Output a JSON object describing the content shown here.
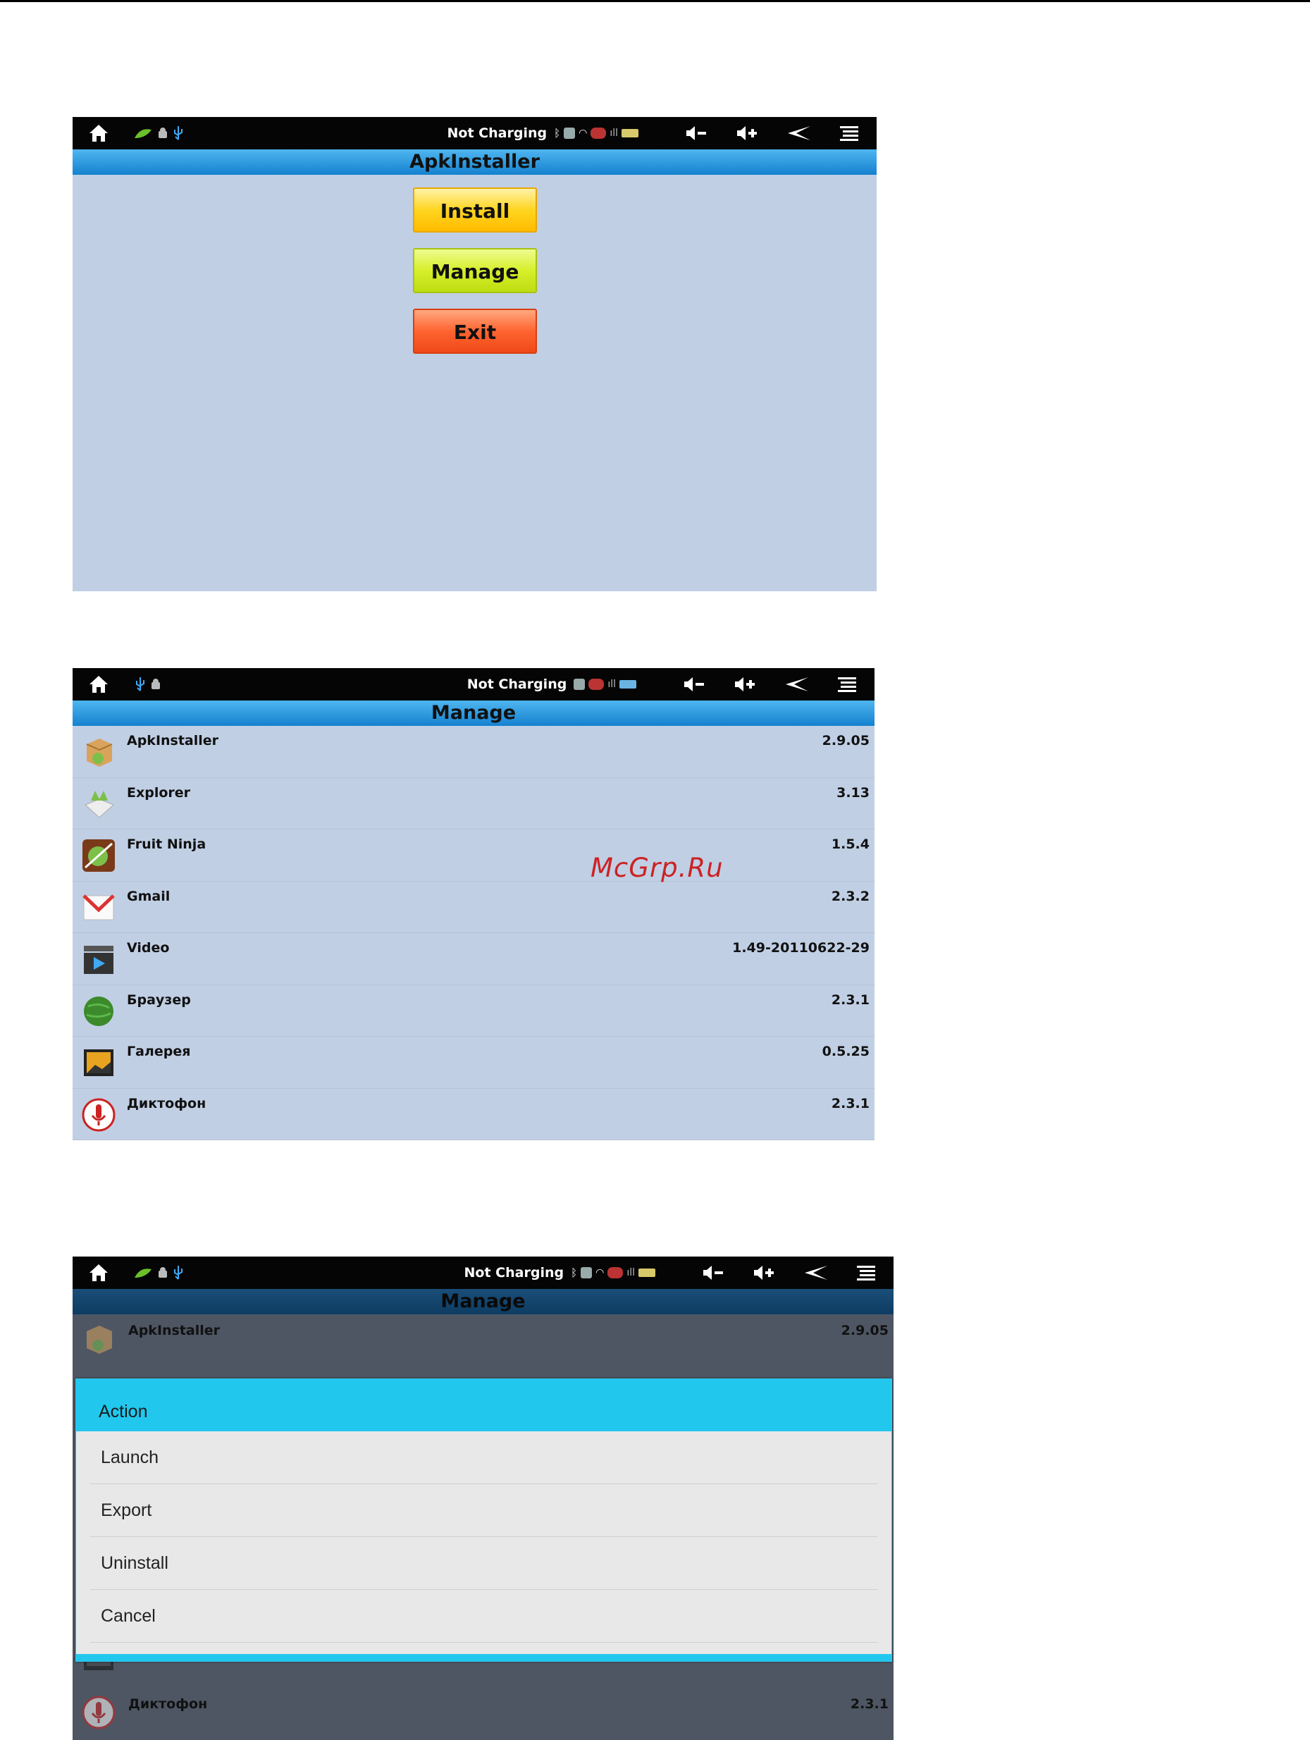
{
  "status_bar": {
    "charging_text": "Not Charging"
  },
  "screen1": {
    "title": "ApkInstaller",
    "buttons": {
      "install": "Install",
      "manage": "Manage",
      "exit": "Exit"
    }
  },
  "screen2": {
    "title": "Manage",
    "apps": [
      {
        "name": "ApkInstaller",
        "version": "2.9.05",
        "icon": "package-icon"
      },
      {
        "name": "Explorer",
        "version": "3.13",
        "icon": "explorer-icon"
      },
      {
        "name": "Fruit Ninja",
        "version": "1.5.4",
        "icon": "fruit-ninja-icon"
      },
      {
        "name": "Gmail",
        "version": "2.3.2",
        "icon": "gmail-icon"
      },
      {
        "name": "Video",
        "version": "1.49-20110622-29",
        "icon": "video-icon"
      },
      {
        "name": "Браузер",
        "version": "2.3.1",
        "icon": "globe-icon"
      },
      {
        "name": "Галерея",
        "version": "0.5.25",
        "icon": "gallery-icon"
      },
      {
        "name": "Диктофон",
        "version": "2.3.1",
        "icon": "microphone-icon"
      }
    ]
  },
  "watermark": "McGrp.Ru",
  "screen3": {
    "title": "Manage",
    "top_app": {
      "name": "ApkInstaller",
      "version": "2.9.05"
    },
    "bottom_app": {
      "name": "Диктофон",
      "version": "2.3.1"
    },
    "dialog": {
      "title": "Action",
      "items": [
        "Launch",
        "Export",
        "Uninstall",
        "Cancel"
      ]
    }
  },
  "colors": {
    "titlebar": "#2196e0",
    "screen_bg": "#c0cfe4",
    "install": "#ffd51f",
    "manage": "#d6ef2a",
    "exit": "#ff6430",
    "dialog_accent": "#22c7ee"
  }
}
